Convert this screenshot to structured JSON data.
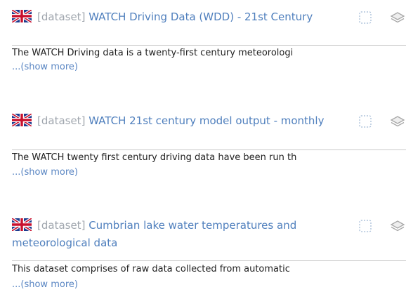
{
  "results": [
    {
      "flag_icon": "uk-flag-icon",
      "prefix": "[dataset]",
      "title": "WATCH Driving Data (WDD) - 21st Century",
      "abstract": "The WATCH Driving data is a twenty-first century meteorologi",
      "show_more": "...(show more)",
      "select_icon": "checkbox-dashed-icon",
      "layers_icon": "layers-icon"
    },
    {
      "flag_icon": "uk-flag-icon",
      "prefix": "[dataset]",
      "title": "WATCH 21st century model output - monthly",
      "abstract": "The WATCH twenty first century driving data have been run th",
      "show_more": "...(show more)",
      "select_icon": "checkbox-dashed-icon",
      "layers_icon": "layers-icon"
    },
    {
      "flag_icon": "uk-flag-icon",
      "prefix": "[dataset]",
      "title": "Cumbrian lake water temperatures and meteorological data",
      "abstract": "This dataset comprises of raw data collected from automatic",
      "show_more": "...(show more)",
      "select_icon": "checkbox-dashed-icon",
      "layers_icon": "layers-icon"
    }
  ],
  "colors": {
    "title_link": "#4f7fbd",
    "prefix": "#a0a6ae",
    "abstract_text": "#222222",
    "show_more": "#5a86c3",
    "divider": "#c9c9c9"
  }
}
